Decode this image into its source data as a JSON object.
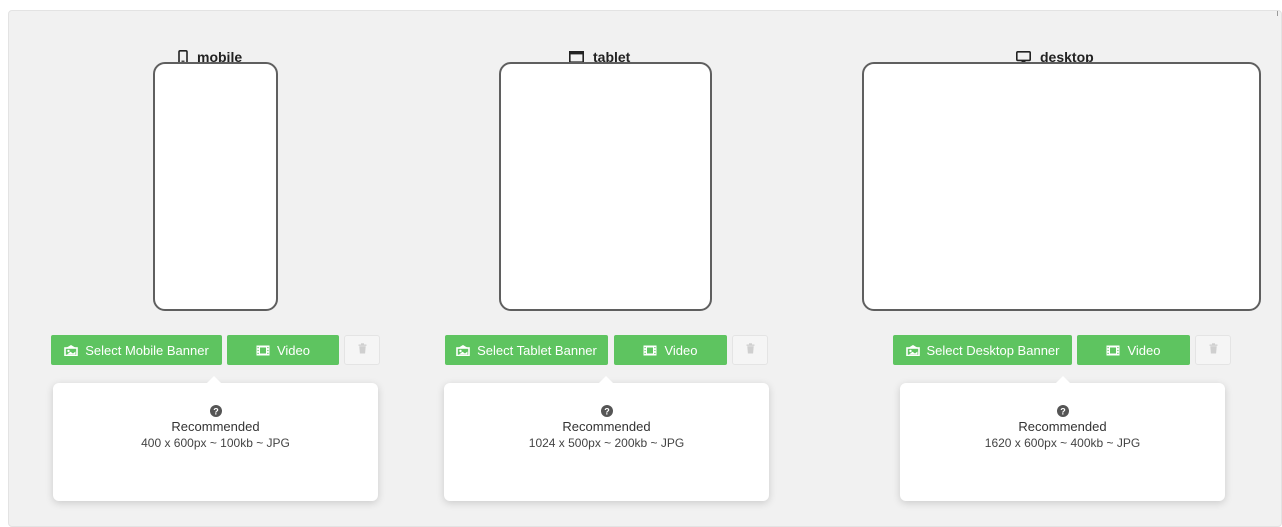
{
  "devices": {
    "mobile": {
      "label": "mobile",
      "icon": "mobile-phone-icon",
      "select_label": "Select Mobile Banner",
      "video_label": "Video",
      "recommended_label": "Recommended",
      "spec": "400 x 600px ~ 100kb ~ JPG"
    },
    "tablet": {
      "label": "tablet",
      "icon": "tablet-icon",
      "select_label": "Select Tablet Banner",
      "video_label": "Video",
      "recommended_label": "Recommended",
      "spec": "1024 x 500px ~ 200kb ~ JPG"
    },
    "desktop": {
      "label": "desktop",
      "icon": "desktop-monitor-icon",
      "select_label": "Select Desktop Banner",
      "video_label": "Video",
      "recommended_label": "Recommended",
      "spec": "1620 x 600px ~ 400kb ~ JPG"
    }
  },
  "icons": {
    "select": "image-icon",
    "video": "film-icon",
    "delete": "trash-icon",
    "help": "question-circle-icon"
  },
  "colors": {
    "accent_green": "#5ec460",
    "panel_bg": "#f1f1f1",
    "frame_border": "#5f5f5f"
  }
}
